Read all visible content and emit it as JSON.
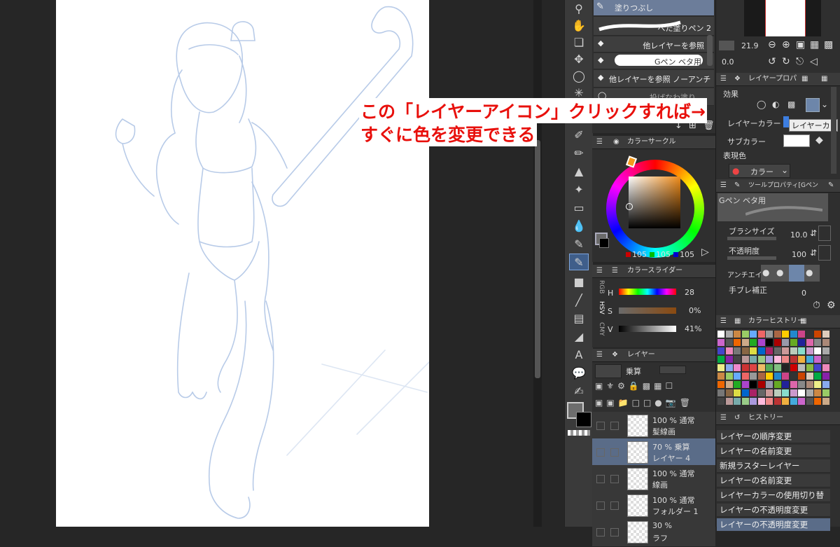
{
  "subtool": {
    "brushes": [
      {
        "label": "塗りつぶし",
        "selected": true
      },
      {
        "label": "べた塗りペン 2",
        "selected": false
      },
      {
        "label": "他レイヤーを参照",
        "selected": false
      },
      {
        "label": "Gペン ベタ用",
        "selected": false
      },
      {
        "label": "他レイヤーを参照 ノーアンチ",
        "selected": false
      },
      {
        "label": "投げなわ塗り",
        "selected": false
      }
    ]
  },
  "color_circle": {
    "title": "カラーサークル",
    "r": "105",
    "g": "105",
    "b": "105"
  },
  "color_slider": {
    "title": "カラースライダー",
    "tabs": [
      "RGB",
      "HSV",
      "CMY"
    ],
    "h_label": "H",
    "h_value": "28",
    "s_label": "S",
    "s_value": "0%",
    "v_label": "V",
    "v_value": "41%"
  },
  "layers": {
    "title": "レイヤー",
    "blend": "乗算",
    "rows": [
      {
        "line1": "100 % 通常",
        "line2": "髪線画",
        "selected": false
      },
      {
        "line1": "70 % 乗算",
        "line2": "レイヤー 4",
        "selected": true
      },
      {
        "line1": "100 % 通常",
        "line2": "線画",
        "selected": false
      },
      {
        "line1": "100 % 通常",
        "line2": "フォルダー 1",
        "selected": false
      },
      {
        "line1": "30 %",
        "line2": "ラフ",
        "selected": false
      }
    ]
  },
  "navigator": {
    "zoom": "21.9",
    "rotate": "0.0"
  },
  "layer_property": {
    "tabs": [
      "レイヤープロパ"
    ],
    "effect_label": "効果",
    "layer_color_label": "レイヤーカラー",
    "sub_color_label": "サブカラー",
    "expression_label": "表現色",
    "expression_value": "カラー",
    "tooltip": "レイヤーカラー"
  },
  "tool_property": {
    "title": "ツールプロパティ[Gペン",
    "brush_name": "Gペン ベタ用",
    "brush_size_label": "ブラシサイズ",
    "brush_size_value": "10.0",
    "opacity_label": "不透明度",
    "opacity_value": "100",
    "antialias_label": "アンチエイリ",
    "stabilization_label": "手ブレ補正",
    "stabilization_value": "0"
  },
  "color_history": {
    "title": "カラーヒストリー"
  },
  "history": {
    "title": "ヒストリー",
    "items": [
      "レイヤーの順序変更",
      "レイヤーの名前変更",
      "新規ラスターレイヤー",
      "レイヤーの名前変更",
      "レイヤーカラーの使用切り替え",
      "レイヤーの不透明度変更",
      "レイヤーの不透明度変更"
    ]
  },
  "annotation": {
    "line1": "この「レイヤーアイコン」クリックすれば→",
    "line2": "すぐに色を変更できる",
    "color": "#e8100c"
  }
}
